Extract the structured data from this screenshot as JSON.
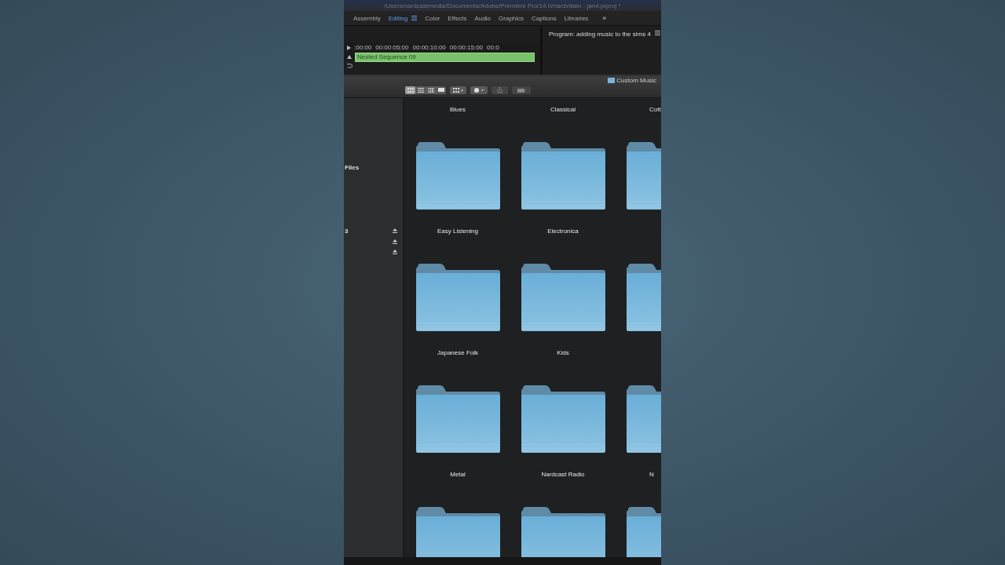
{
  "window": {
    "title": "/Users/nardcastmedia/Documents/Adobe/Premiere Pro/14.0/nardvillain - jan4.prproj *"
  },
  "workspaces": [
    {
      "label": "Assembly",
      "selected": false
    },
    {
      "label": "Editing",
      "selected": true
    },
    {
      "label": "Color",
      "selected": false
    },
    {
      "label": "Effects",
      "selected": false
    },
    {
      "label": "Audio",
      "selected": false
    },
    {
      "label": "Graphics",
      "selected": false
    },
    {
      "label": "Captions",
      "selected": false
    },
    {
      "label": "Libraries",
      "selected": false
    }
  ],
  "workspaces_more": "»",
  "timeline": {
    "ruler": [
      ":00:00",
      "00:00:05:00",
      "00:00:10:00",
      "00:00:15:00",
      "00:0"
    ],
    "clip": "Nested Sequence 09"
  },
  "program_monitor": {
    "title": "Program: adding music to the sims 4"
  },
  "finder": {
    "path": "Custom Music",
    "view_modes": [
      {
        "selected": true
      },
      {
        "selected": false
      },
      {
        "selected": false
      },
      {
        "selected": false
      }
    ],
    "sidebar": [
      {
        "label": "Files",
        "eject": false
      },
      {
        "label": "3",
        "eject": true
      },
      {
        "eject": true
      },
      {
        "eject": true
      }
    ],
    "folders": [
      {
        "kind": "folder",
        "label": "Blues"
      },
      {
        "kind": "folder",
        "label": "Classical"
      },
      {
        "kind": "folder",
        "label": "Cott"
      },
      {
        "kind": "folder",
        "label": "Easy Listening"
      },
      {
        "kind": "folder",
        "label": "Electronica"
      },
      {
        "kind": "folder"
      },
      {
        "kind": "folder",
        "label": "Japanese Folk"
      },
      {
        "kind": "folder",
        "label": "Kids"
      },
      {
        "kind": "folder"
      },
      {
        "kind": "folder",
        "label": "Metal"
      },
      {
        "kind": "folder",
        "label": "Nardcast Radio"
      },
      {
        "kind": "folder",
        "label": "N"
      }
    ]
  }
}
